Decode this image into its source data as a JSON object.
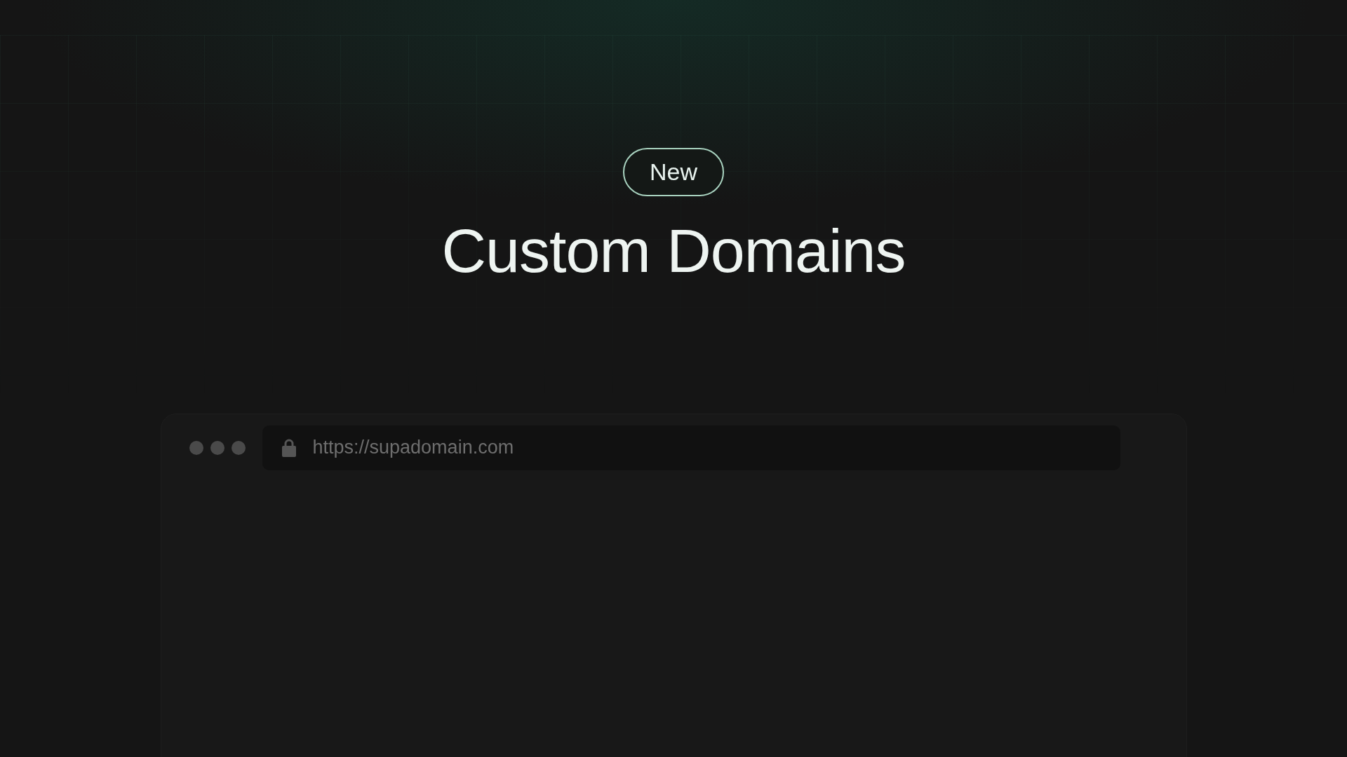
{
  "badge": "New",
  "title": "Custom Domains",
  "browser": {
    "url": "https://supadomain.com"
  }
}
